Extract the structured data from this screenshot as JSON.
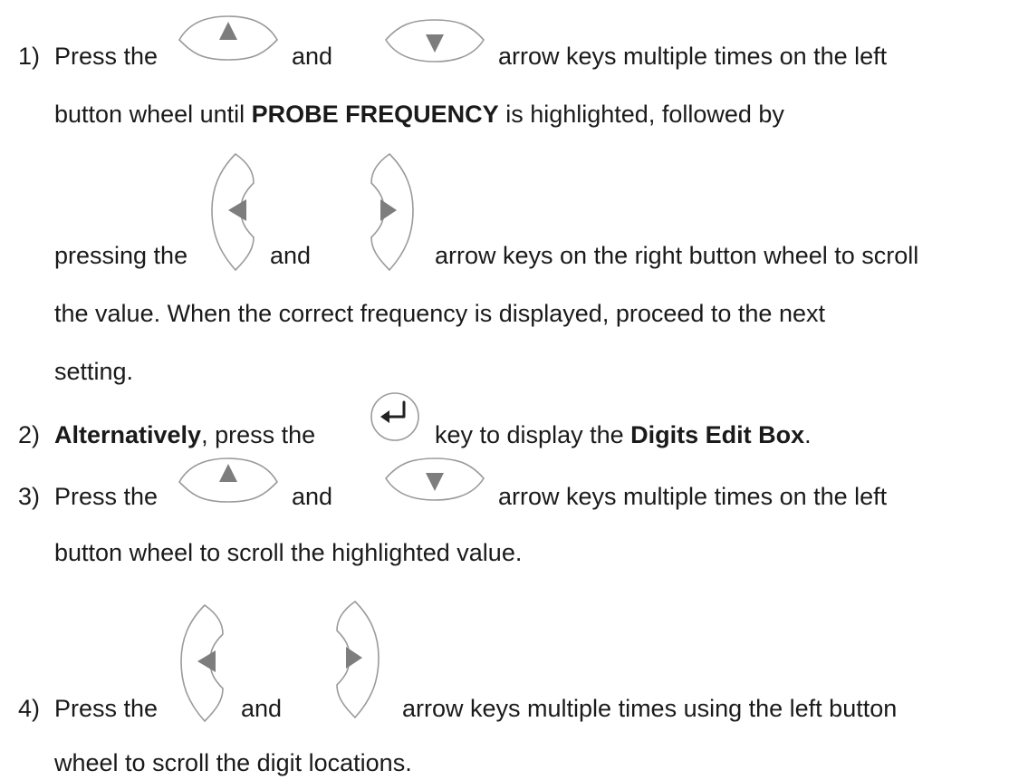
{
  "steps": [
    {
      "number": "1)",
      "t1": "Press the",
      "t2": "and",
      "t3": "arrow keys multiple times on the left",
      "t4a": "button wheel until ",
      "t4b": "PROBE FREQUENCY",
      "t4c": " is highlighted, followed by",
      "t5a": "pressing the",
      "t5b": "and",
      "t5c": "arrow keys on the right button wheel to scroll",
      "t6": "the value.  When the correct frequency is displayed, proceed to the next",
      "t7": "setting."
    },
    {
      "number": "2)",
      "t1a": "Alternatively",
      "t1b": ", press the",
      "t1c": "key to display the ",
      "t1d": "Digits Edit Box",
      "t1e": "."
    },
    {
      "number": "3)",
      "t1": "Press the",
      "t2": "and",
      "t3": "arrow keys multiple times on the left",
      "t4": "button wheel to scroll the highlighted value."
    },
    {
      "number": "4)",
      "t1": "Press the",
      "t2": "and",
      "t3": "arrow keys multiple times using the left button",
      "t4": "wheel to scroll the digit locations."
    }
  ],
  "icons": {
    "up": "up-arrow-key-icon",
    "down": "down-arrow-key-icon",
    "left": "left-arrow-key-icon",
    "right": "right-arrow-key-icon",
    "enter": "enter-key-icon"
  }
}
